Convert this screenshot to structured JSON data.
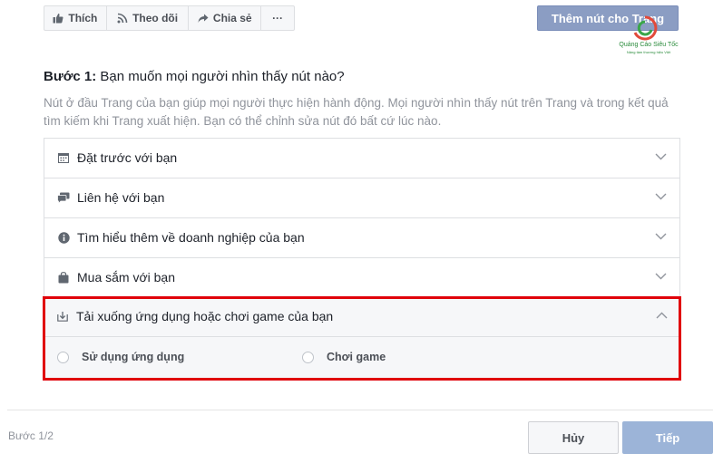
{
  "toolbar": {
    "like_label": "Thích",
    "follow_label": "Theo dõi",
    "share_label": "Chia sẻ",
    "more_label": "···",
    "add_button_label": "Thêm nút cho Trang"
  },
  "watermark": {
    "name": "Quảng Cáo Siêu Tốc",
    "sub": "Nâng tầm thương hiệu Việt"
  },
  "step_heading": {
    "prefix": "Bước 1:",
    "text": " Bạn muốn mọi người nhìn thấy nút nào?"
  },
  "description": "Nút ở đầu Trang của bạn giúp mọi người thực hiện hành động. Mọi người nhìn thấy nút trên Trang và trong kết quả tìm kiếm khi Trang xuất hiện. Bạn có thể chỉnh sửa nút đó bất cứ lúc nào.",
  "options": [
    {
      "label": "Đặt trước với bạn",
      "icon": "calendar-icon"
    },
    {
      "label": "Liên hệ với bạn",
      "icon": "chat-icon"
    },
    {
      "label": "Tìm hiểu thêm về doanh nghiệp của bạn",
      "icon": "info-icon"
    },
    {
      "label": "Mua sắm với bạn",
      "icon": "shopping-bag-icon"
    }
  ],
  "expanded_option": {
    "label": "Tải xuống ứng dụng hoặc chơi game của bạn",
    "icon": "download-icon",
    "choices": [
      "Sử dụng ứng dụng",
      "Chơi game"
    ]
  },
  "footer": {
    "step_text": "Bước 1/2",
    "cancel_label": "Hủy",
    "next_label": "Tiếp"
  },
  "colors": {
    "highlight": "#e0000a",
    "add_button_bg": "#8b9dc3",
    "next_button_bg": "#9cb4d8"
  }
}
